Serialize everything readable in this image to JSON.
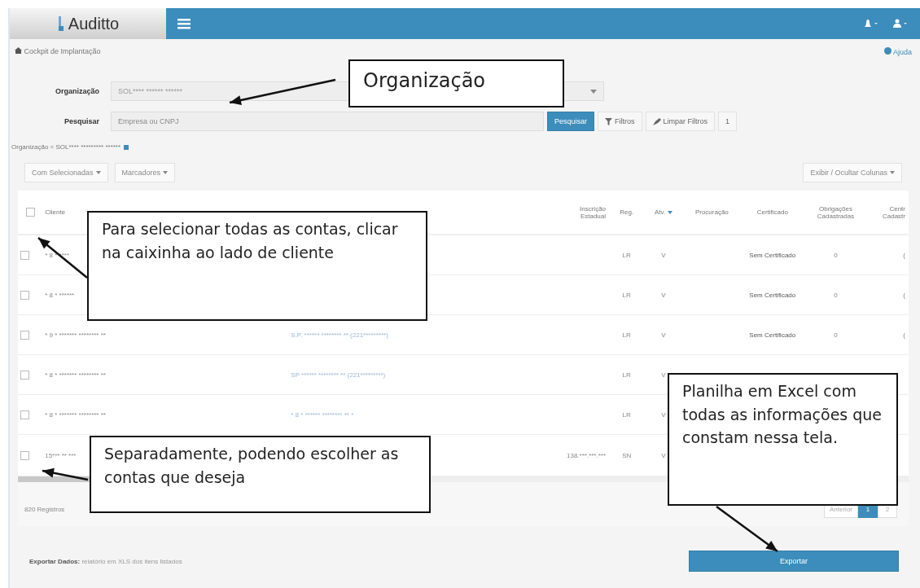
{
  "header": {
    "brand": "Auditto",
    "icons": [
      {
        "kind": "bell"
      },
      {
        "kind": "user"
      }
    ]
  },
  "breadcrumb": "Cockpit de Implantação",
  "help": "Ajuda",
  "filters": {
    "org_label": "Organização",
    "org_value": "SOL**** ****** ******",
    "search_label": "Pesquisar",
    "search_placeholder": "Empresa ou CNPJ",
    "search_button": "Pesquisar",
    "filters_button": "Filtros",
    "clear_button": "Limpar Filtros",
    "count": "1",
    "active_filter": "Organização = SOL**** ********* ******"
  },
  "toolbar": {
    "left": [
      "Com Selecionadas",
      "Marcadores"
    ],
    "right": "Exibir / Ocultar Colunas"
  },
  "table": {
    "header_checked": false,
    "columns": [
      {
        "label": "Cliente"
      },
      {},
      {
        "label": "Inscrição Estadual"
      },
      {
        "label": "Reg."
      },
      {
        "label": "Atv.",
        "sorted": true
      },
      {
        "label": "Procuração"
      },
      {
        "label": "Certificado"
      },
      {
        "label": "Obrigações Cadastradas"
      },
      {
        "label": "Centr Cadastr"
      }
    ],
    "rows": [
      {
        "checked": false,
        "cells": [
          "* 8 * ****",
          "",
          "",
          "LR",
          "V",
          "",
          "Sem Certificado",
          "0",
          "("
        ]
      },
      {
        "checked": false,
        "cells": [
          "* 8 * ******",
          "",
          "",
          "LR",
          "V",
          "",
          "Sem Certificado",
          "0",
          "("
        ]
      },
      {
        "checked": false,
        "cells": [
          "* 9 * ******* ******** **",
          "S.P. ****** ******** ** (221*********)",
          "",
          "LR",
          "V",
          "",
          "Sem Certificado",
          "0",
          "("
        ]
      },
      {
        "checked": false,
        "cells": [
          "* 8 * ******* ******** **",
          "SP ****** ******** ** (221*********)",
          "",
          "LR",
          "V",
          "",
          "",
          "",
          ""
        ]
      },
      {
        "checked": false,
        "cells": [
          "* 8 * ******* ******** **",
          "* 8 * ****** ******** ** *",
          "",
          "LR",
          "V",
          "",
          "",
          "",
          ""
        ]
      },
      {
        "checked": false,
        "cells": [
          "15*** ** ***",
          "",
          "138.***.***.***",
          "SN",
          "V",
          "",
          "",
          "",
          ""
        ]
      }
    ]
  },
  "footer": {
    "records": "820 Registros",
    "pagination": [
      {
        "label": "Anterior",
        "selected": false
      },
      {
        "label": "1",
        "selected": true
      },
      {
        "label": "2",
        "selected": false
      }
    ]
  },
  "export": {
    "text": "**Exportar Dados:** relatório em XLS dos itens listados",
    "button": "Exportar"
  },
  "callouts": [
    {
      "text": "Organização"
    },
    {
      "text": "Para selecionar todas as contas, clicar na caixinha ao lado de cliente"
    },
    {
      "text": "Separadamente, podendo escolher as contas que deseja"
    },
    {
      "text": "Planilha em Excel com todas as informações que constam nessa tela."
    }
  ]
}
